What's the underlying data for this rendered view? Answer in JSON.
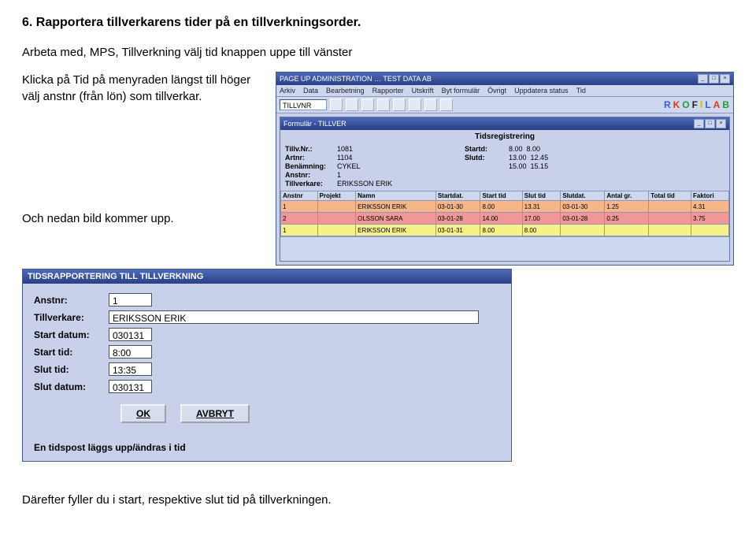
{
  "heading": "6. Rapportera tillverkarens tider på en tillverkningsorder.",
  "intro": "Arbeta med, MPS, Tillverkning välj tid  knappen uppe till vänster",
  "left": {
    "p1": "Klicka på Tid på menyraden längst till höger välj anstnr (från lön) som tillverkar.",
    "p2": "Och nedan bild kommer upp."
  },
  "win": {
    "title": "PAGE UP ADMINISTRATION … TEST DATA AB",
    "menu": [
      "Arkiv",
      "Data",
      "Bearbetning",
      "Rapporter",
      "Utskrift",
      "Byt formulär",
      "Övrigt",
      "Uppdatera status",
      "Tid"
    ],
    "tbfield": "TILLVNR",
    "brand": [
      "R",
      "K",
      "O",
      "F",
      "I",
      "L",
      "A",
      "B"
    ],
    "inner_title": "Formulär - TILLVER",
    "sec_title": "Tidsregistrering",
    "form": {
      "labels": {
        "tillvnr": "Tillv.Nr.:",
        "artnr": "Artnr:",
        "benamning": "Benämning:",
        "anstnr": "Anstnr:",
        "tillverkare": "Tillverkare:",
        "startd": "Startd:",
        "slutd": "Slutd:"
      },
      "tillvnr": "1081",
      "artnr": "1104",
      "benamning": "CYKEL",
      "anstnr": "1",
      "tillverkare": "ERIKSSON ERIK",
      "startd": [
        "8.00",
        "8.00"
      ],
      "slutd1": [
        "13.00",
        "12.45"
      ],
      "slutd2": [
        "15.00",
        "15.15"
      ]
    },
    "cols": [
      "Anstnr",
      "Projekt",
      "Namn",
      "Startdat.",
      "Start tid",
      "Slut tid",
      "Slutdat.",
      "Antal gr.",
      "Total tid",
      "Faktori"
    ],
    "rows": [
      {
        "cls": "r-orange",
        "c": [
          "1",
          "",
          "ERIKSSON ERIK",
          "03-01-30",
          "8.00",
          "13.31",
          "03-01-30",
          "1.25",
          "",
          "4.31"
        ]
      },
      {
        "cls": "r-red",
        "c": [
          "2",
          "",
          "OLSSON SARA",
          "03-01-28",
          "14.00",
          "17.00",
          "03-01-28",
          "0.25",
          "",
          "3.75"
        ]
      },
      {
        "cls": "r-yellow",
        "c": [
          "1",
          "",
          "ERIKSSON ERIK",
          "03-01-31",
          "8.00",
          "8.00",
          "",
          "",
          "",
          ""
        ]
      }
    ]
  },
  "dlg": {
    "title": "TIDSRAPPORTERING TILL TILLVERKNING",
    "labels": {
      "anstnr": "Anstnr:",
      "tillverkare": "Tillverkare:",
      "startdat": "Start datum:",
      "starttid": "Start tid:",
      "sluttid": "Slut tid:",
      "slutdat": "Slut datum:"
    },
    "anstnr": "1",
    "tillverkare": "ERIKSSON ERIK",
    "startdat": "030131",
    "starttid": "8:00",
    "sluttid": "13:35",
    "slutdat": "030131",
    "ok": "OK",
    "cancel": "AVBRYT",
    "footer": "En tidspost läggs upp/ändras i tid"
  },
  "final": "Därefter fyller du i start, respektive slut tid på tillverkningen."
}
